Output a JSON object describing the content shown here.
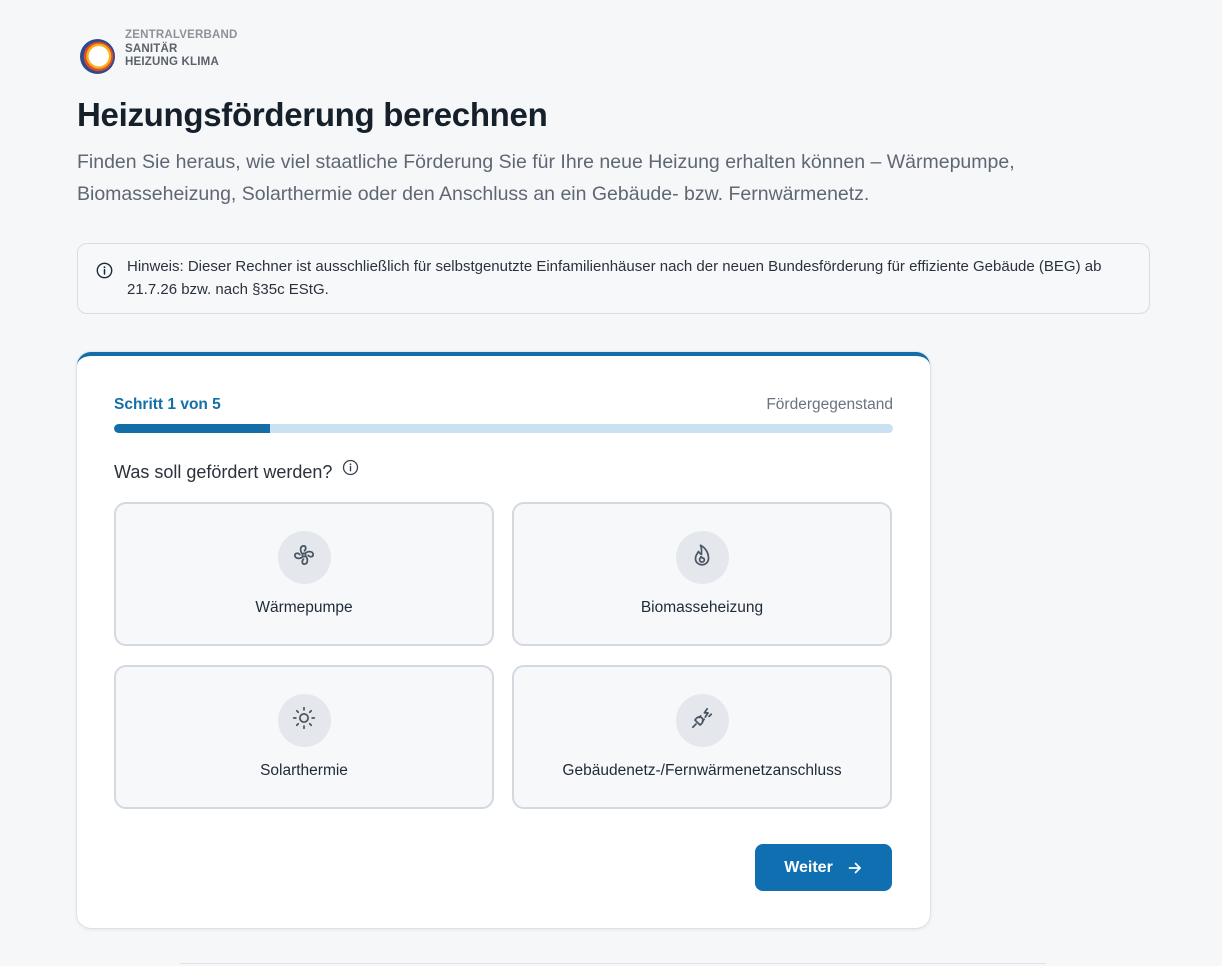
{
  "colors": {
    "accent": "#136ea8",
    "button": "#0f6fb1",
    "progress_track": "#c9e1f0",
    "title": "#15202b"
  },
  "logo": {
    "line1": "ZENTRALVERBAND",
    "line2": "SANITÄR",
    "line3": "HEIZUNG KLIMA"
  },
  "page": {
    "title": "Heizungsförderung berechnen",
    "subtitle": "Finden Sie heraus, wie viel staatliche Förderung Sie für Ihre neue Heizung erhalten können – Wärmepumpe, Biomasseheizung, Solarthermie oder den Anschluss an ein Gebäude- bzw. Fernwärmenetz."
  },
  "notice": {
    "icon": "info-icon",
    "text": "Hinweis: Dieser Rechner ist ausschließlich für selbstgenutzte Einfamilienhäuser nach der neuen Bundesförderung für effiziente Gebäude (BEG) ab 21.7.26 bzw. nach §35c EStG."
  },
  "wizard": {
    "step_label": "Schritt 1 von 5",
    "step_name": "Fördergegenstand",
    "progress_fraction": 0.2,
    "question": "Was soll gefördert werden?",
    "options": [
      {
        "label": "Wärmepumpe",
        "icon": "fan-icon"
      },
      {
        "label": "Biomasseheizung",
        "icon": "flame-icon"
      },
      {
        "label": "Solarthermie",
        "icon": "sun-icon"
      },
      {
        "label": "Gebäudenetz-/Fernwärmenetzanschluss",
        "icon": "plug-icon"
      }
    ],
    "next_button": "Weiter"
  }
}
